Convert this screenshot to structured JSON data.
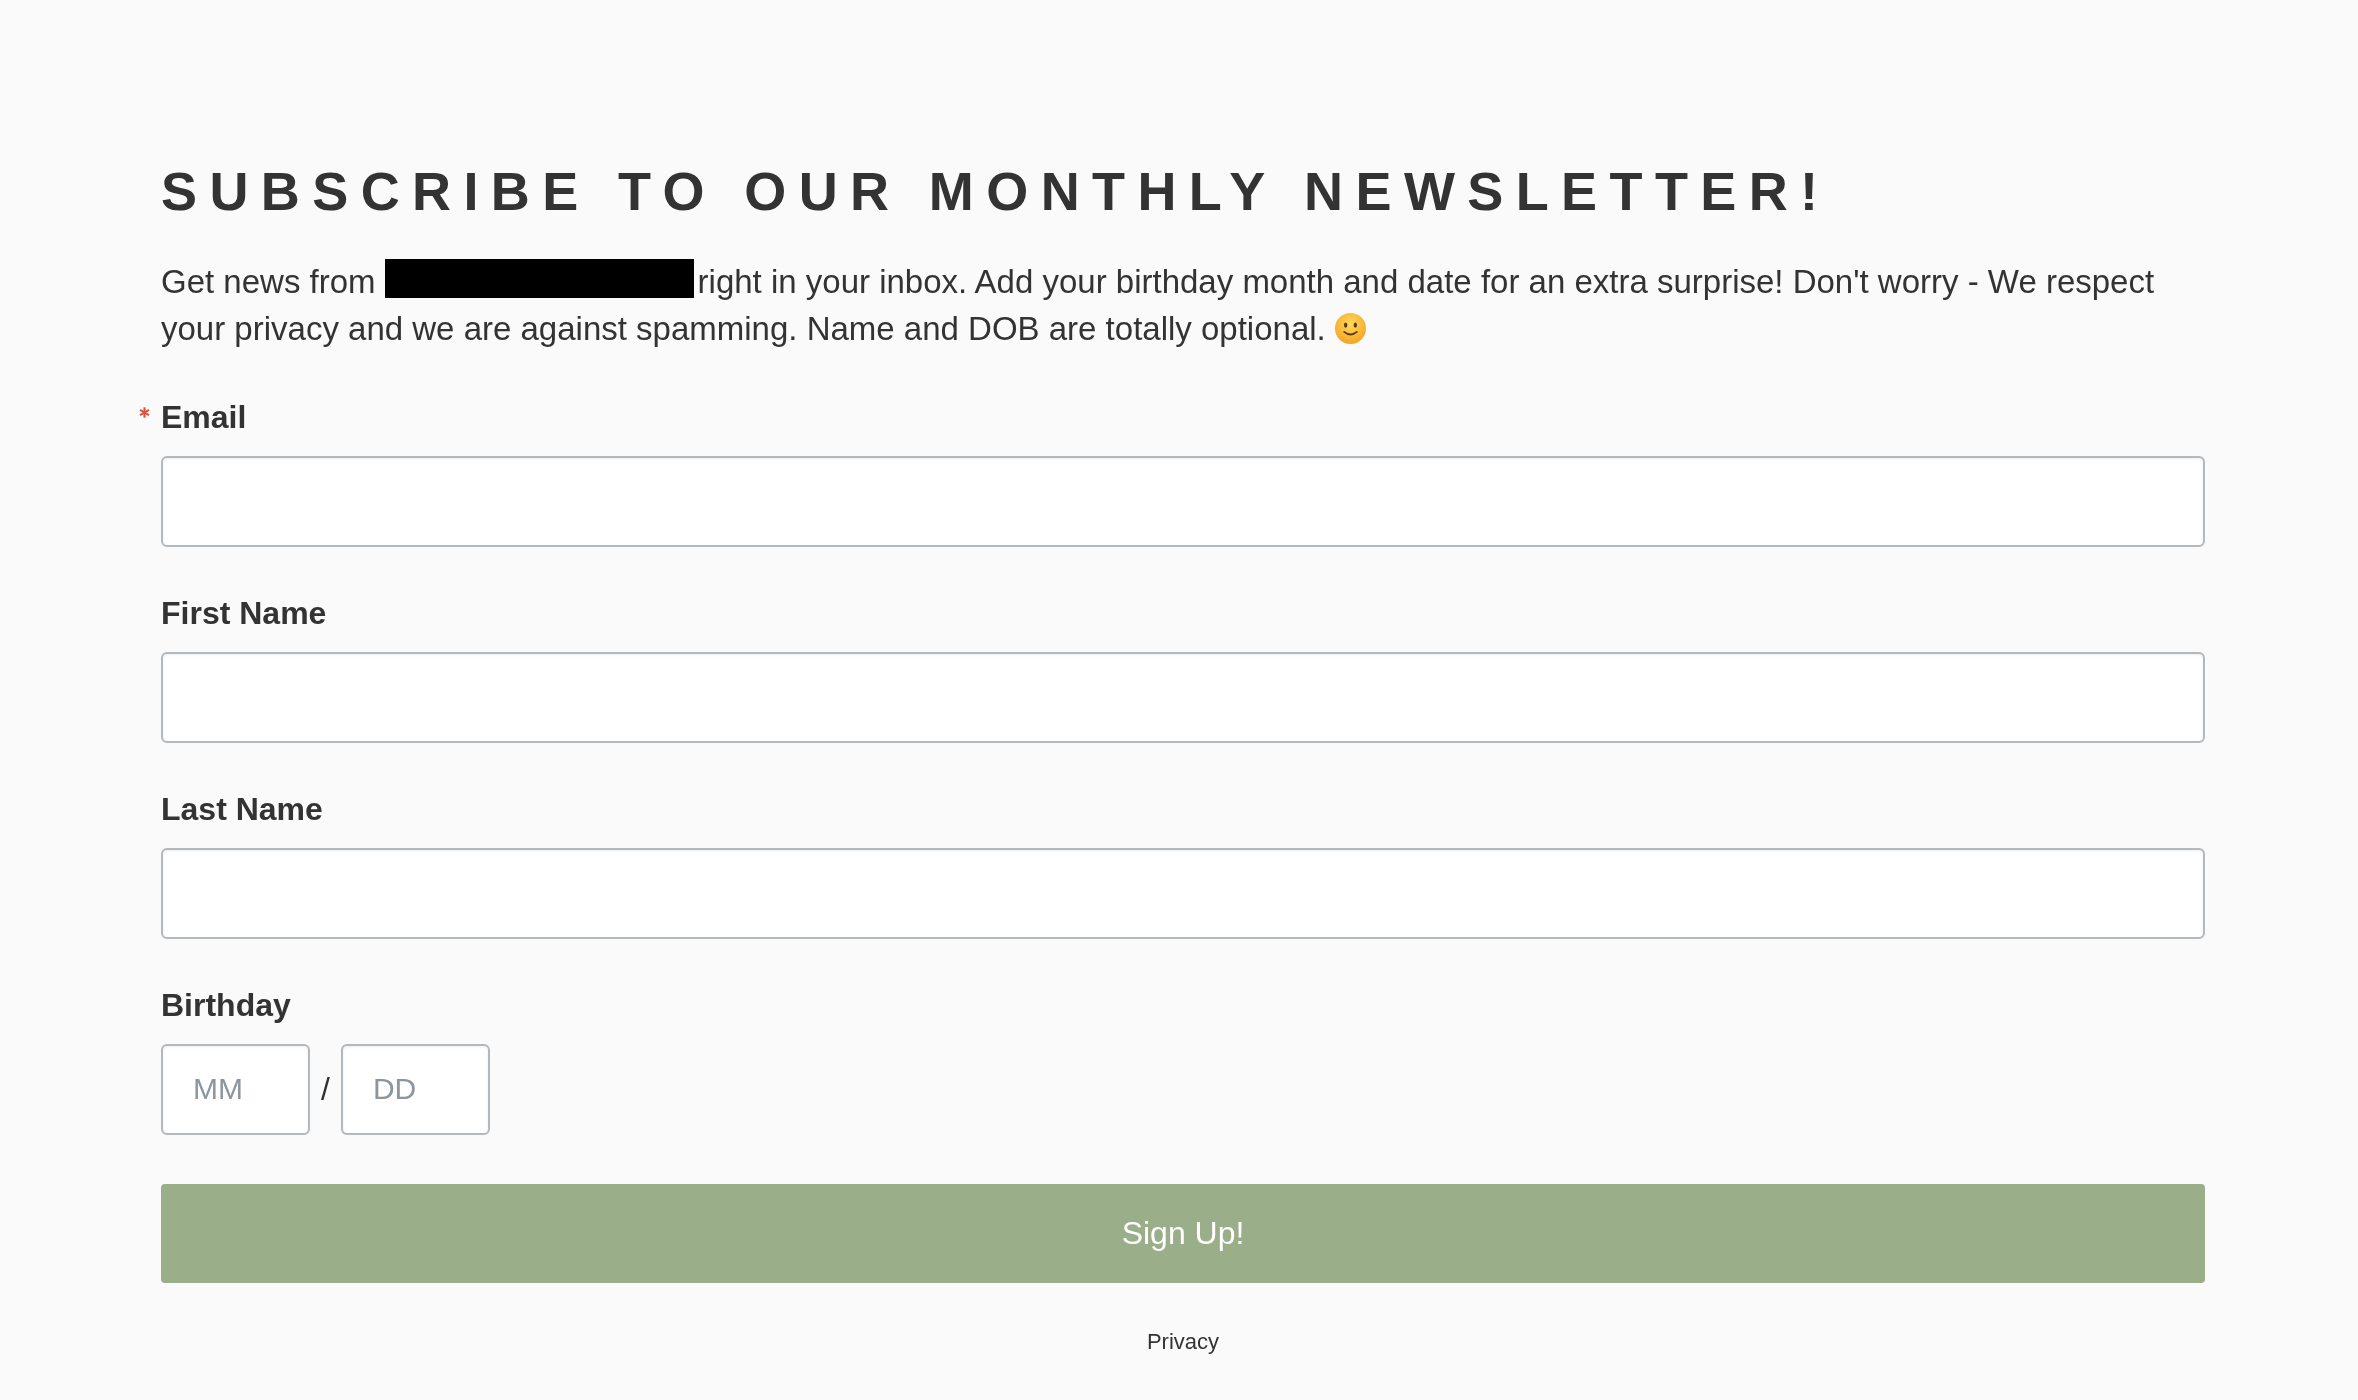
{
  "title": "SUBSCRIBE TO OUR MONTHLY NEWSLETTER!",
  "intro": {
    "lines": [
      [
        {
          "kind": "text",
          "text": "Get news from"
        },
        {
          "kind": "redaction"
        },
        {
          "kind": "text",
          "text": "right in your inbox. Add your birthday month and date for an extra surprise! Don't worry - We respect"
        }
      ],
      [
        {
          "kind": "text",
          "text": "your privacy and we are against spamming. Name and DOB are totally optional."
        },
        {
          "kind": "emoji"
        }
      ]
    ]
  },
  "fields": [
    {
      "kind": "text",
      "label": "Email",
      "required": true
    },
    {
      "kind": "text",
      "label": "First Name",
      "required": false
    },
    {
      "kind": "text",
      "label": "Last Name",
      "required": false
    },
    {
      "kind": "date",
      "label": "Birthday",
      "required": false,
      "parts": [
        {
          "placeholder": "MM"
        },
        {
          "placeholder": "DD"
        }
      ],
      "separator": "/"
    }
  ],
  "submit": {
    "label": "Sign Up!"
  },
  "footer": {
    "privacy_link": "Privacy"
  }
}
